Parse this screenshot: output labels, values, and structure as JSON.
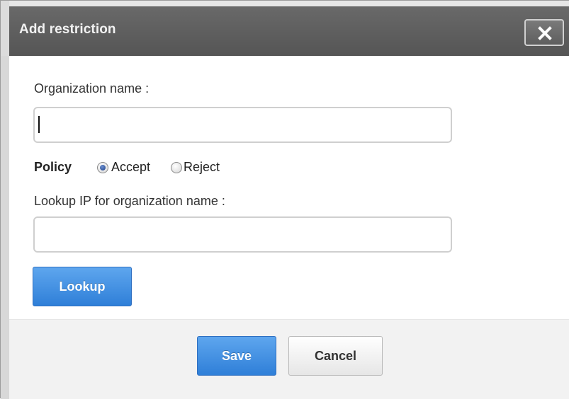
{
  "dialog": {
    "title": "Add restriction",
    "close_icon": "close-icon"
  },
  "form": {
    "org_name_label": "Organization name :",
    "org_name_value": "",
    "policy_label": "Policy",
    "policy_options": [
      {
        "label": "Accept",
        "selected": true
      },
      {
        "label": "Reject",
        "selected": false
      }
    ],
    "lookup_label": "Lookup IP for organization name :",
    "lookup_value": "",
    "lookup_button": "Lookup"
  },
  "footer": {
    "save_label": "Save",
    "cancel_label": "Cancel"
  },
  "colors": {
    "titlebar": "#5e5e5e",
    "primary_button": "#3a86dc",
    "footer_bg": "#f2f2f2"
  }
}
